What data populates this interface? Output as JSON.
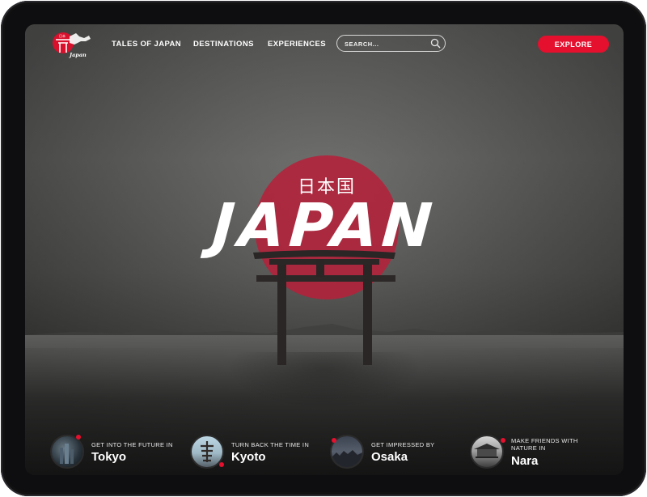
{
  "nav": {
    "logo_kanji": "日本",
    "logo_text": "Japan",
    "links": [
      "TALES OF JAPAN",
      "DESTINATIONS",
      "EXPERIENCES"
    ],
    "search_placeholder": "SEARCH...",
    "explore_label": "EXPLORE"
  },
  "hero": {
    "kanji": "日本国",
    "title": "JAPAN"
  },
  "destinations": [
    {
      "subtitle": "GET INTO THE FUTURE IN",
      "name": "Tokyo"
    },
    {
      "subtitle": "TURN BACK THE TIME IN",
      "name": "Kyoto"
    },
    {
      "subtitle": "GET IMPRESSED BY",
      "name": "Osaka"
    },
    {
      "subtitle": "MAKE FRIENDS WITH NATURE IN",
      "name": "Nara"
    }
  ],
  "colors": {
    "accent": "#e4102d",
    "sun": "#b5213a",
    "device": "#0e0e10"
  },
  "icons": [
    "search-icon",
    "torii-gate-icon",
    "japan-logo-icon"
  ]
}
